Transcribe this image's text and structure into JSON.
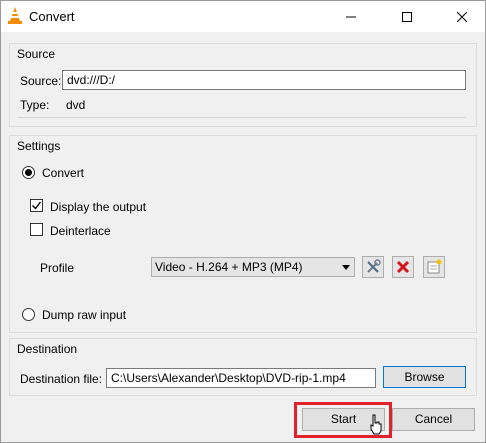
{
  "window": {
    "title": "Convert",
    "icon": "vlc-cone-icon",
    "controls": [
      "minimize-icon",
      "maximize-icon",
      "close-icon"
    ]
  },
  "source": {
    "group_label": "Source",
    "source_label": "Source:",
    "source_value": "dvd:///D:/",
    "type_label": "Type:",
    "type_value": "dvd"
  },
  "settings": {
    "group_label": "Settings",
    "convert_label": "Convert",
    "convert_selected": true,
    "display_output_label": "Display the output",
    "display_output_checked": true,
    "deinterlace_label": "Deinterlace",
    "deinterlace_checked": false,
    "profile_label": "Profile",
    "profile_value": "Video - H.264 + MP3 (MP4)",
    "profile_buttons": [
      "wrench-screwdriver-icon",
      "red-x-delete-icon",
      "new-profile-icon"
    ],
    "dump_raw_label": "Dump raw input",
    "dump_raw_selected": false
  },
  "destination": {
    "group_label": "Destination",
    "file_label": "Destination file:",
    "file_value": "C:\\Users\\Alexander\\Desktop\\DVD-rip-1.mp4",
    "browse_label": "Browse"
  },
  "footer": {
    "start_label": "Start",
    "cancel_label": "Cancel",
    "highlight_color": "#e0202a"
  }
}
